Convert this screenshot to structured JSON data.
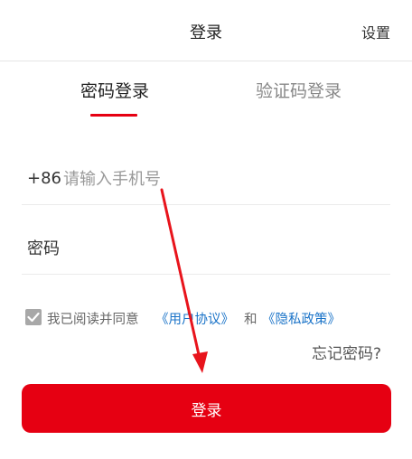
{
  "header": {
    "title": "登录",
    "settings_label": "设置"
  },
  "tabs": [
    {
      "label": "密码登录",
      "active": true
    },
    {
      "label": "验证码登录",
      "active": false
    }
  ],
  "phone": {
    "country_code": "+86",
    "placeholder": "请输入手机号",
    "value": ""
  },
  "password": {
    "placeholder": "密码",
    "value": ""
  },
  "agreement": {
    "checked": true,
    "text": "我已阅读并同意",
    "user_link": "《用户协议》",
    "and": "和",
    "privacy_link": "《隐私政策》"
  },
  "forgot_password": "忘记密码?",
  "login_button": "登录",
  "colors": {
    "accent": "#e60012",
    "link": "#1a73c8",
    "checkbox": "#a8a8a8"
  }
}
